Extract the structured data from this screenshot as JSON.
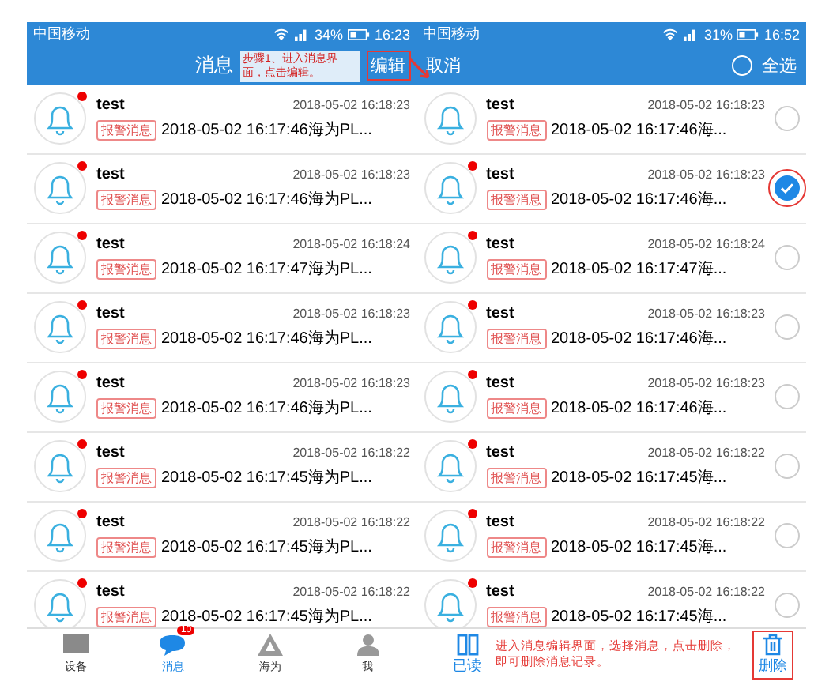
{
  "phones": [
    {
      "kind": "list",
      "status_bar": {
        "carrier": "中国移动",
        "battery": "34%",
        "time": "16:23"
      },
      "header": {
        "title": "消息",
        "annotation": "步骤1、进入消息界面，点击编辑。",
        "action": "编辑"
      },
      "messages": [
        {
          "title": "test",
          "time": "2018-05-02 16:18:23",
          "tag": "报警消息",
          "text": "2018-05-02 16:17:46海为PL...",
          "unread": true
        },
        {
          "title": "test",
          "time": "2018-05-02 16:18:23",
          "tag": "报警消息",
          "text": "2018-05-02 16:17:46海为PL...",
          "unread": true
        },
        {
          "title": "test",
          "time": "2018-05-02 16:18:24",
          "tag": "报警消息",
          "text": "2018-05-02 16:17:47海为PL...",
          "unread": true
        },
        {
          "title": "test",
          "time": "2018-05-02 16:18:23",
          "tag": "报警消息",
          "text": "2018-05-02 16:17:46海为PL...",
          "unread": true
        },
        {
          "title": "test",
          "time": "2018-05-02 16:18:23",
          "tag": "报警消息",
          "text": "2018-05-02 16:17:46海为PL...",
          "unread": true
        },
        {
          "title": "test",
          "time": "2018-05-02 16:18:22",
          "tag": "报警消息",
          "text": "2018-05-02 16:17:45海为PL...",
          "unread": true
        },
        {
          "title": "test",
          "time": "2018-05-02 16:18:22",
          "tag": "报警消息",
          "text": "2018-05-02 16:17:45海为PL...",
          "unread": true
        },
        {
          "title": "test",
          "time": "2018-05-02 16:18:22",
          "tag": "报警消息",
          "text": "2018-05-02 16:17:45海为PL...",
          "unread": true
        }
      ],
      "tab_bar": [
        {
          "label": "设备",
          "selected": false,
          "kind": "device"
        },
        {
          "label": "消息",
          "selected": true,
          "kind": "message",
          "badge": "10"
        },
        {
          "label": "海为",
          "selected": false,
          "kind": "logo"
        },
        {
          "label": "我",
          "selected": false,
          "kind": "person"
        }
      ]
    },
    {
      "kind": "edit",
      "status_bar": {
        "carrier": "中国移动",
        "battery": "31%",
        "time": "16:52"
      },
      "header": {
        "cancel": "取消",
        "select_all": "全选",
        "selected": false
      },
      "messages": [
        {
          "title": "test",
          "time": "2018-05-02 16:18:23",
          "tag": "报警消息",
          "text": "2018-05-02 16:17:46海...",
          "unread": false,
          "selected": false
        },
        {
          "title": "test",
          "time": "2018-05-02 16:18:23",
          "tag": "报警消息",
          "text": "2018-05-02 16:17:46海...",
          "unread": true,
          "selected": true
        },
        {
          "title": "test",
          "time": "2018-05-02 16:18:24",
          "tag": "报警消息",
          "text": "2018-05-02 16:17:47海...",
          "unread": true,
          "selected": false
        },
        {
          "title": "test",
          "time": "2018-05-02 16:18:23",
          "tag": "报警消息",
          "text": "2018-05-02 16:17:46海...",
          "unread": true,
          "selected": false
        },
        {
          "title": "test",
          "time": "2018-05-02 16:18:23",
          "tag": "报警消息",
          "text": "2018-05-02 16:17:46海...",
          "unread": true,
          "selected": false
        },
        {
          "title": "test",
          "time": "2018-05-02 16:18:22",
          "tag": "报警消息",
          "text": "2018-05-02 16:17:45海...",
          "unread": true,
          "selected": false
        },
        {
          "title": "test",
          "time": "2018-05-02 16:18:22",
          "tag": "报警消息",
          "text": "2018-05-02 16:17:45海...",
          "unread": true,
          "selected": false
        },
        {
          "title": "test",
          "time": "2018-05-02 16:18:22",
          "tag": "报警消息",
          "text": "2018-05-02 16:17:45海...",
          "unread": true,
          "selected": false
        }
      ],
      "bottom_bar": {
        "read": "已读",
        "annotation": "进入消息编辑界面，选择消息，点击删除，即可删除消息记录。",
        "delete": "删除"
      }
    }
  ]
}
